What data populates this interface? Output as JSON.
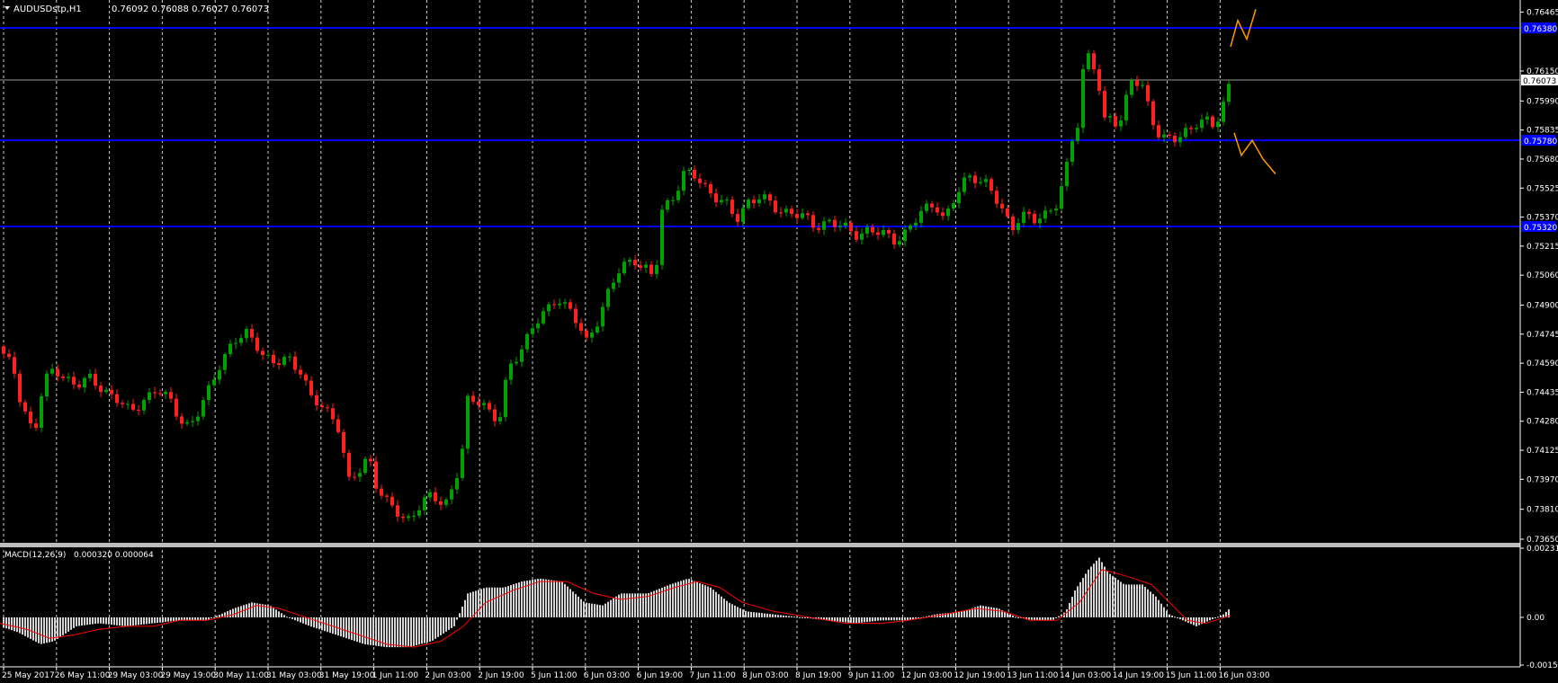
{
  "main": {
    "title": "AUDUSDstp,H1",
    "ohlc": "0.76092 0.76088 0.76027 0.76073"
  },
  "macd": {
    "title": "MACD(12,26,9)",
    "values": "0.000320 0.000064"
  },
  "colors": {
    "background": "#000000",
    "bull": "#00a000",
    "bear": "#ff2020",
    "level_line": "#0000ff",
    "current_price_line": "#9a9a9a",
    "projection": "#ff9900",
    "histogram": "#d4d4d4",
    "signal": "#ff0000",
    "grid": "#d0d0d0"
  },
  "chart_data": [
    {
      "type": "candlestick",
      "symbol": "AUDUSDstp",
      "timeframe": "H1",
      "y_ticks": [
        "0.76465",
        "0.76150",
        "0.75990",
        "0.75835",
        "0.75680",
        "0.75525",
        "0.75370",
        "0.75215",
        "0.75060",
        "0.74900",
        "0.74745",
        "0.74590",
        "0.74435",
        "0.74280",
        "0.74125",
        "0.73970",
        "0.73810",
        "0.73650"
      ],
      "x_ticks": [
        "25 May 2017",
        "26 May 11:00",
        "29 May 03:00",
        "29 May 19:00",
        "30 May 11:00",
        "31 May 03:00",
        "31 May 19:00",
        "1 Jun 11:00",
        "2 Jun 03:00",
        "2 Jun 19:00",
        "5 Jun 11:00",
        "6 Jun 03:00",
        "6 Jun 19:00",
        "7 Jun 11:00",
        "8 Jun 03:00",
        "8 Jun 19:00",
        "9 Jun 11:00",
        "12 Jun 03:00",
        "12 Jun 19:00",
        "13 Jun 11:00",
        "14 Jun 03:00",
        "14 Jun 19:00",
        "15 Jun 11:00",
        "16 Jun 03:00"
      ],
      "ylim": [
        0.7365,
        0.7651
      ],
      "current_price": "0.76073",
      "levels": [
        {
          "value": 0.7638,
          "label": "0.76380"
        },
        {
          "value": 0.7578,
          "label": "0.75780"
        },
        {
          "value": 0.7532,
          "label": "0.75320"
        }
      ],
      "close_path": [
        [
          0,
          0.7468
        ],
        [
          6,
          0.7462
        ],
        [
          15,
          0.7455
        ],
        [
          22,
          0.744
        ],
        [
          30,
          0.743
        ],
        [
          38,
          0.7422
        ],
        [
          48,
          0.7448
        ],
        [
          60,
          0.7455
        ],
        [
          70,
          0.7452
        ],
        [
          85,
          0.7448
        ],
        [
          100,
          0.745
        ],
        [
          115,
          0.7445
        ],
        [
          130,
          0.744
        ],
        [
          145,
          0.7432
        ],
        [
          160,
          0.744
        ],
        [
          175,
          0.7445
        ],
        [
          190,
          0.7438
        ],
        [
          200,
          0.743
        ],
        [
          210,
          0.7425
        ],
        [
          218,
          0.743
        ],
        [
          230,
          0.7442
        ],
        [
          245,
          0.746
        ],
        [
          260,
          0.747
        ],
        [
          275,
          0.7475
        ],
        [
          285,
          0.747
        ],
        [
          295,
          0.7462
        ],
        [
          305,
          0.7458
        ],
        [
          320,
          0.7462
        ],
        [
          335,
          0.7455
        ],
        [
          345,
          0.744
        ],
        [
          360,
          0.7435
        ],
        [
          375,
          0.7428
        ],
        [
          388,
          0.7395
        ],
        [
          400,
          0.7402
        ],
        [
          410,
          0.741
        ],
        [
          418,
          0.7395
        ],
        [
          428,
          0.7385
        ],
        [
          440,
          0.738
        ],
        [
          452,
          0.7375
        ],
        [
          465,
          0.7382
        ],
        [
          480,
          0.7388
        ],
        [
          495,
          0.7384
        ],
        [
          505,
          0.7395
        ],
        [
          513,
          0.7408
        ],
        [
          520,
          0.7438
        ],
        [
          535,
          0.744
        ],
        [
          548,
          0.743
        ],
        [
          555,
          0.7428
        ],
        [
          565,
          0.7455
        ],
        [
          580,
          0.7468
        ],
        [
          595,
          0.748
        ],
        [
          610,
          0.7488
        ],
        [
          620,
          0.7495
        ],
        [
          632,
          0.7488
        ],
        [
          642,
          0.748
        ],
        [
          652,
          0.747
        ],
        [
          662,
          0.748
        ],
        [
          675,
          0.7495
        ],
        [
          690,
          0.751
        ],
        [
          705,
          0.7515
        ],
        [
          720,
          0.7508
        ],
        [
          728,
          0.7502
        ],
        [
          735,
          0.754
        ],
        [
          748,
          0.7548
        ],
        [
          760,
          0.756
        ],
        [
          775,
          0.7558
        ],
        [
          790,
          0.755
        ],
        [
          805,
          0.7545
        ],
        [
          818,
          0.7535
        ],
        [
          830,
          0.7545
        ],
        [
          845,
          0.7548
        ],
        [
          860,
          0.7542
        ],
        [
          875,
          0.754
        ],
        [
          890,
          0.7538
        ],
        [
          905,
          0.7532
        ],
        [
          920,
          0.7535
        ],
        [
          935,
          0.7532
        ],
        [
          950,
          0.7528
        ],
        [
          965,
          0.753
        ],
        [
          980,
          0.7528
        ],
        [
          995,
          0.7525
        ],
        [
          1010,
          0.753
        ],
        [
          1025,
          0.754
        ],
        [
          1040,
          0.7545
        ],
        [
          1050,
          0.7535
        ],
        [
          1060,
          0.7545
        ],
        [
          1070,
          0.7555
        ],
        [
          1080,
          0.756
        ],
        [
          1095,
          0.7555
        ],
        [
          1105,
          0.7548
        ],
        [
          1115,
          0.754
        ],
        [
          1125,
          0.7532
        ],
        [
          1135,
          0.7538
        ],
        [
          1150,
          0.7535
        ],
        [
          1165,
          0.754
        ],
        [
          1175,
          0.7545
        ],
        [
          1185,
          0.756
        ],
        [
          1190,
          0.7575
        ],
        [
          1195,
          0.7582
        ],
        [
          1200,
          0.759
        ],
        [
          1206,
          0.7628
        ],
        [
          1212,
          0.7622
        ],
        [
          1220,
          0.7615
        ],
        [
          1226,
          0.7585
        ],
        [
          1232,
          0.759
        ],
        [
          1240,
          0.7588
        ],
        [
          1248,
          0.759
        ],
        [
          1256,
          0.7612
        ],
        [
          1262,
          0.761
        ],
        [
          1270,
          0.7605
        ],
        [
          1280,
          0.759
        ],
        [
          1290,
          0.758
        ],
        [
          1300,
          0.758
        ],
        [
          1310,
          0.7578
        ],
        [
          1320,
          0.7582
        ],
        [
          1330,
          0.7588
        ],
        [
          1340,
          0.759
        ],
        [
          1350,
          0.7585
        ],
        [
          1358,
          0.7592
        ],
        [
          1366,
          0.7607
        ]
      ],
      "projection_paths": [
        [
          [
            1368,
            0.7628
          ],
          [
            1376,
            0.7642
          ],
          [
            1386,
            0.7632
          ],
          [
            1396,
            0.7648
          ]
        ],
        [
          [
            1372,
            0.7582
          ],
          [
            1380,
            0.757
          ],
          [
            1392,
            0.7578
          ],
          [
            1404,
            0.7568
          ],
          [
            1418,
            0.756
          ]
        ]
      ]
    },
    {
      "type": "macd",
      "params": [
        12,
        26,
        9
      ],
      "y_ticks": [
        "0.002316",
        "0.00",
        "-0.001597"
      ],
      "ylim": [
        -0.001597,
        0.002316
      ],
      "hist_path": [
        [
          0,
          -0.0003
        ],
        [
          20,
          -0.0005
        ],
        [
          45,
          -0.0009
        ],
        [
          60,
          -0.0008
        ],
        [
          85,
          -0.0003
        ],
        [
          110,
          -0.0002
        ],
        [
          140,
          -0.0003
        ],
        [
          170,
          -0.0002
        ],
        [
          200,
          -0.0001
        ],
        [
          230,
          -0.0001
        ],
        [
          260,
          0.0003
        ],
        [
          280,
          0.0005
        ],
        [
          300,
          0.0004
        ],
        [
          320,
          0.0
        ],
        [
          345,
          -0.0003
        ],
        [
          375,
          -0.0006
        ],
        [
          405,
          -0.0009
        ],
        [
          430,
          -0.001
        ],
        [
          455,
          -0.001
        ],
        [
          480,
          -0.0008
        ],
        [
          505,
          -0.0003
        ],
        [
          520,
          0.0008
        ],
        [
          540,
          0.001
        ],
        [
          560,
          0.001
        ],
        [
          580,
          0.0012
        ],
        [
          600,
          0.0013
        ],
        [
          625,
          0.0012
        ],
        [
          650,
          0.0005
        ],
        [
          670,
          0.0004
        ],
        [
          690,
          0.0008
        ],
        [
          720,
          0.0008
        ],
        [
          745,
          0.0011
        ],
        [
          765,
          0.0013
        ],
        [
          790,
          0.001
        ],
        [
          810,
          0.0005
        ],
        [
          830,
          0.0002
        ],
        [
          860,
          0.0001
        ],
        [
          890,
          0.0
        ],
        [
          920,
          -0.0001
        ],
        [
          950,
          -0.0002
        ],
        [
          980,
          -0.0001
        ],
        [
          1010,
          -0.0001
        ],
        [
          1040,
          0.0001
        ],
        [
          1070,
          0.0002
        ],
        [
          1090,
          0.0004
        ],
        [
          1110,
          0.0003
        ],
        [
          1130,
          0.0
        ],
        [
          1150,
          -0.0001
        ],
        [
          1170,
          -0.0001
        ],
        [
          1185,
          0.0002
        ],
        [
          1195,
          0.0009
        ],
        [
          1210,
          0.0016
        ],
        [
          1222,
          0.002
        ],
        [
          1232,
          0.0015
        ],
        [
          1250,
          0.0011
        ],
        [
          1270,
          0.0011
        ],
        [
          1285,
          0.0007
        ],
        [
          1300,
          0.0001
        ],
        [
          1315,
          -0.0001
        ],
        [
          1330,
          -0.0003
        ],
        [
          1345,
          -0.0001
        ],
        [
          1360,
          0.0001
        ],
        [
          1368,
          0.00032
        ]
      ],
      "signal_path": [
        [
          0,
          -0.0002
        ],
        [
          30,
          -0.0004
        ],
        [
          55,
          -0.0007
        ],
        [
          80,
          -0.0006
        ],
        [
          110,
          -0.0004
        ],
        [
          140,
          -0.0003
        ],
        [
          170,
          -0.0003
        ],
        [
          200,
          -0.0001
        ],
        [
          230,
          -0.0001
        ],
        [
          260,
          0.0001
        ],
        [
          285,
          0.0004
        ],
        [
          310,
          0.0003
        ],
        [
          340,
          0.0
        ],
        [
          370,
          -0.0003
        ],
        [
          400,
          -0.0006
        ],
        [
          430,
          -0.0009
        ],
        [
          460,
          -0.001
        ],
        [
          490,
          -0.0008
        ],
        [
          515,
          -0.0003
        ],
        [
          540,
          0.0005
        ],
        [
          570,
          0.0009
        ],
        [
          600,
          0.0012
        ],
        [
          630,
          0.0012
        ],
        [
          660,
          0.0008
        ],
        [
          690,
          0.0006
        ],
        [
          720,
          0.0007
        ],
        [
          750,
          0.001
        ],
        [
          775,
          0.0012
        ],
        [
          800,
          0.001
        ],
        [
          825,
          0.0005
        ],
        [
          860,
          0.0002
        ],
        [
          900,
          0.0
        ],
        [
          940,
          -0.0002
        ],
        [
          980,
          -0.0002
        ],
        [
          1010,
          -0.0001
        ],
        [
          1050,
          0.0001
        ],
        [
          1085,
          0.0003
        ],
        [
          1115,
          0.0002
        ],
        [
          1145,
          -0.0001
        ],
        [
          1175,
          -0.0001
        ],
        [
          1200,
          0.0005
        ],
        [
          1225,
          0.0016
        ],
        [
          1250,
          0.0014
        ],
        [
          1280,
          0.0011
        ],
        [
          1300,
          0.0005
        ],
        [
          1320,
          -0.0001
        ],
        [
          1340,
          -0.0002
        ],
        [
          1368,
          6.4e-05
        ]
      ]
    }
  ]
}
